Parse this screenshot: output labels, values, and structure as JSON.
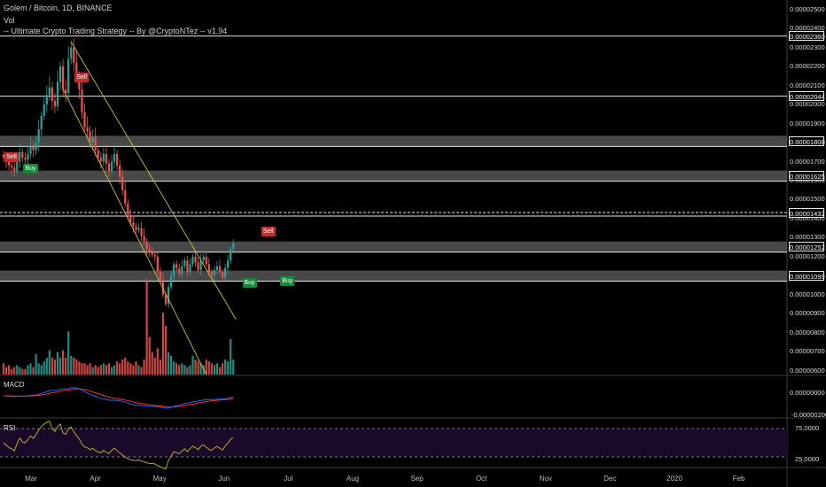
{
  "header": {
    "symbol_line": "Golem / Bitcoin, 1D, BINANCE",
    "vol_label": "Vol",
    "strategy_line": "-- Ultimate Crypto Trading Strategy -- By @CryptoNTez -- v1.94"
  },
  "colors": {
    "background": "#000000",
    "up_candle": "#26a69a",
    "down_candle": "#ef5350",
    "channel": "#c8c23a",
    "zone": "#5a5a5a",
    "macd_line": "#2962ff",
    "signal_line": "#ff2d2d",
    "rsi_line": "#c9b72e",
    "rsi_band": "#1a0a2a",
    "sell": "#c42d2d",
    "buy": "#138a3a"
  },
  "price_axis": {
    "ticks": [
      "0.00002500",
      "0.00002400",
      "0.00002300",
      "0.00002200",
      "0.00002100",
      "0.00002000",
      "0.00001900",
      "0.00001800",
      "0.00001700",
      "0.00001600",
      "0.00001500",
      "0.00001400",
      "0.00001300",
      "0.00001200",
      "0.00001000",
      "0.00000900",
      "0.00000800",
      "0.00000700",
      "0.00000600"
    ],
    "ylim": [
      5.8e-06,
      2.55e-05
    ],
    "levels": [
      {
        "value": "0.00002360",
        "style": "solid"
      },
      {
        "value": "0.00002044",
        "style": "solid"
      },
      {
        "value": "0.00001808",
        "style": "zone"
      },
      {
        "value": "0.00001625",
        "style": "zone"
      },
      {
        "value": "0.00001432",
        "style": "dashed"
      },
      {
        "value": "0.00001252",
        "style": "zone"
      },
      {
        "value": "0.00001099",
        "style": "zone"
      }
    ]
  },
  "macd_panel": {
    "title": "MACD",
    "ticks": [
      "0.00000000",
      "-0.00000200"
    ]
  },
  "rsi_panel": {
    "title": "RSI",
    "ticks": [
      "75.0000",
      "25.0000"
    ],
    "upper": 70,
    "lower": 30
  },
  "x_axis": {
    "labels": [
      "Mar",
      "Apr",
      "May",
      "Jun",
      "Jul",
      "Aug",
      "Sep",
      "Oct",
      "Nov",
      "Dec",
      "2020",
      "Feb"
    ]
  },
  "signals": [
    {
      "type": "sell",
      "label": "Sell",
      "day": 2,
      "price": 1.72e-05
    },
    {
      "type": "buy",
      "label": "Buy",
      "day": 9,
      "price": 1.66e-05
    },
    {
      "type": "sell",
      "label": "Sell",
      "day": 28,
      "price": 2.14e-05
    },
    {
      "type": "sell",
      "label": "Sell",
      "day": 97,
      "price": 1.33e-05
    },
    {
      "type": "buy",
      "label": "Buy",
      "day": 90,
      "price": 1.06e-05
    },
    {
      "type": "buy",
      "label": "Buy",
      "day": 104,
      "price": 1.07e-05
    }
  ],
  "chart_data": {
    "type": "candlestick",
    "title": "Golem / Bitcoin, 1D, BINANCE",
    "x_start": "Feb 25",
    "closes": [
      1.72e-05,
      1.7e-05,
      1.68e-05,
      1.67e-05,
      1.65e-05,
      1.7e-05,
      1.75e-05,
      1.72e-05,
      1.71e-05,
      1.74e-05,
      1.78e-05,
      1.76e-05,
      1.8e-05,
      1.87e-05,
      1.94e-05,
      2e-05,
      2.05e-05,
      2.09e-05,
      2.02e-05,
      1.99e-05,
      2.12e-05,
      2.2e-05,
      2.08e-05,
      2.06e-05,
      2.24e-05,
      2.3e-05,
      2.22e-05,
      2.15e-05,
      2.08e-05,
      1.96e-05,
      1.88e-05,
      1.86e-05,
      1.8e-05,
      1.83e-05,
      1.76e-05,
      1.72e-05,
      1.7e-05,
      1.74e-05,
      1.69e-05,
      1.65e-05,
      1.7e-05,
      1.74e-05,
      1.68e-05,
      1.62e-05,
      1.55e-05,
      1.48e-05,
      1.42e-05,
      1.38e-05,
      1.36e-05,
      1.34e-05,
      1.35e-05,
      1.31e-05,
      1.28e-05,
      1.24e-05,
      1.22e-05,
      1.21e-05,
      1.2e-05,
      1.12e-05,
      1.08e-05,
      1e-05,
      9.5e-06,
      1.04e-05,
      1.1e-05,
      1.16e-05,
      1.14e-05,
      1.11e-05,
      1.15e-05,
      1.18e-05,
      1.12e-05,
      1.16e-05,
      1.2e-05,
      1.17e-05,
      1.13e-05,
      1.18e-05,
      1.2e-05,
      1.16e-05,
      1.12e-05,
      1.1e-05,
      1.13e-05,
      1.15e-05,
      1.12e-05,
      1.09e-05,
      1.14e-05,
      1.18e-05,
      1.24e-05,
      1.27e-05
    ],
    "volumes": [
      0.6,
      0.4,
      0.5,
      0.3,
      0.4,
      0.5,
      0.4,
      0.3,
      0.3,
      0.5,
      0.6,
      0.4,
      1.1,
      0.6,
      0.5,
      0.7,
      0.9,
      1.3,
      0.9,
      0.8,
      1.2,
      0.9,
      1.3,
      0.9,
      2.3,
      1.0,
      0.9,
      0.8,
      0.7,
      0.6,
      0.6,
      0.5,
      0.6,
      0.4,
      0.5,
      0.4,
      0.5,
      0.6,
      0.5,
      0.6,
      0.4,
      0.5,
      0.7,
      0.6,
      0.8,
      0.9,
      0.7,
      0.6,
      0.5,
      0.7,
      0.5,
      0.4,
      0.8,
      5.1,
      2.0,
      1.2,
      0.9,
      1.4,
      0.8,
      3.3,
      2.6,
      1.2,
      1.0,
      0.7,
      0.6,
      0.5,
      0.6,
      0.5,
      0.4,
      0.5,
      1.0,
      0.8,
      0.7,
      0.6,
      0.5,
      0.8,
      0.7,
      0.6,
      0.5,
      0.6,
      0.4,
      0.6,
      0.8,
      0.7,
      1.9,
      0.8
    ],
    "ylim": [
      5.8e-06,
      2.55e-05
    ]
  }
}
